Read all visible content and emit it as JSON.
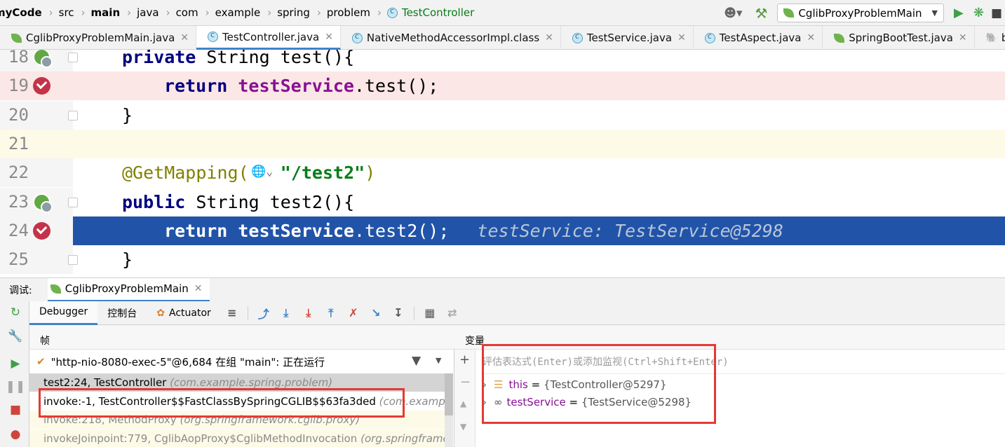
{
  "breadcrumb": {
    "items": [
      "myCode",
      "src",
      "main",
      "java",
      "com",
      "example",
      "spring",
      "problem"
    ],
    "current": "TestController"
  },
  "run_config": {
    "label": "CglibProxyProblemMain"
  },
  "tabs": [
    {
      "label": "CglibProxyProblemMain.java",
      "kind": "spring"
    },
    {
      "label": "TestController.java",
      "kind": "class",
      "active": true
    },
    {
      "label": "NativeMethodAccessorImpl.class",
      "kind": "class"
    },
    {
      "label": "TestService.java",
      "kind": "class"
    },
    {
      "label": "TestAspect.java",
      "kind": "class"
    },
    {
      "label": "SpringBootTest.java",
      "kind": "spring"
    },
    {
      "label": "build.g",
      "kind": "gradle"
    }
  ],
  "editor": {
    "lines": [
      {
        "num": "18",
        "indent": 0,
        "parts": [
          {
            "t": "private",
            "c": "kw"
          },
          {
            "t": " String test(){",
            "c": ""
          }
        ],
        "mark": "spring"
      },
      {
        "num": "19",
        "indent": 1,
        "parts": [
          {
            "t": "return",
            "c": "kw"
          },
          {
            "t": " ",
            "c": ""
          },
          {
            "t": "testService",
            "c": "fld"
          },
          {
            "t": ".test();",
            "c": ""
          }
        ],
        "mark": "breakpoint",
        "bg": "#fbe7e5"
      },
      {
        "num": "20",
        "indent": 0,
        "parts": [
          {
            "t": "}",
            "c": ""
          }
        ],
        "mark": ""
      },
      {
        "num": "21",
        "indent": 0,
        "parts": [],
        "mark": "",
        "bg": "#fdfbe8"
      },
      {
        "num": "22",
        "indent": 0,
        "parts": [
          {
            "t": "@GetMapping(",
            "c": "ann"
          },
          {
            "t": "   ",
            "c": ""
          },
          {
            "t": "\"/test2\"",
            "c": "str"
          },
          {
            "t": ")",
            "c": "ann"
          }
        ],
        "mark": ""
      },
      {
        "num": "23",
        "indent": 0,
        "parts": [
          {
            "t": "public",
            "c": "kw"
          },
          {
            "t": " String test2(){",
            "c": ""
          }
        ],
        "mark": "spring"
      },
      {
        "num": "24",
        "indent": 1,
        "parts": [
          {
            "t": "return",
            "c": "kw"
          },
          {
            "t": " ",
            "c": ""
          },
          {
            "t": "testService",
            "c": "fld"
          },
          {
            "t": ".test2();",
            "c": ""
          }
        ],
        "mark": "breakpoint",
        "bg": "#2154a8",
        "current": true,
        "inlay": "testService: TestService@5298"
      },
      {
        "num": "25",
        "indent": 0,
        "parts": [
          {
            "t": "}",
            "c": ""
          }
        ],
        "mark": ""
      }
    ]
  },
  "debug": {
    "title_label": "调试:",
    "session": "CglibProxyProblemMain",
    "tabs": [
      "Debugger",
      "控制台",
      "Actuator"
    ],
    "frames_header": "帧",
    "vars_header": "变量",
    "thread": "\"http-nio-8080-exec-5\"@6,684 在组 \"main\": 正在运行",
    "frames": [
      {
        "method": "test2:24, TestController",
        "pkg": "(com.example.spring.problem)",
        "selected": true
      },
      {
        "method": "invoke:-1, TestController$$FastClassBySpringCGLIB$$63fa3ded",
        "pkg": "(com.example.sp"
      },
      {
        "method": "invoke:218, MethodProxy",
        "pkg": "(org.springframework.cglib.proxy)",
        "library": true
      },
      {
        "method": "invokeJoinpoint:779, CglibAopProxy$CglibMethodInvocation",
        "pkg": "(org.springframew",
        "library": true
      }
    ],
    "eval_placeholder": "评估表达式(Enter)或添加监视(Ctrl+Shift+Enter)",
    "variables": [
      {
        "name": "this",
        "value": "{TestController@5297}",
        "icon": "field-icon"
      },
      {
        "name": "testService",
        "value": "{TestService@5298}",
        "icon": "watch-icon"
      }
    ]
  }
}
